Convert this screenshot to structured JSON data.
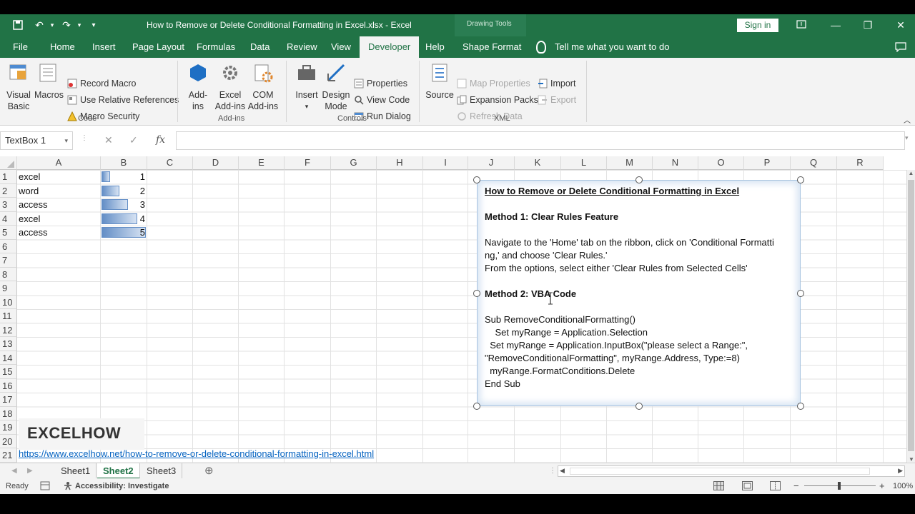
{
  "window": {
    "title": "How to Remove or Delete Conditional Formatting in Excel.xlsx  -  Excel",
    "context_label": "Drawing Tools",
    "sign_in": "Sign in"
  },
  "tabs": [
    "File",
    "Home",
    "Insert",
    "Page Layout",
    "Formulas",
    "Data",
    "Review",
    "View",
    "Developer",
    "Help",
    "Shape Format"
  ],
  "active_tab": "Developer",
  "tell_me": "Tell me what you want to do",
  "ribbon": {
    "code": {
      "label": "Code",
      "visual_basic": "Visual Basic",
      "macros": "Macros",
      "record_macro": "Record Macro",
      "relative_refs": "Use Relative References",
      "macro_security": "Macro Security"
    },
    "addins": {
      "label": "Add-ins",
      "addins": "Add-ins",
      "excel_addins": "Excel Add-ins",
      "com_addins": "COM Add-ins"
    },
    "controls": {
      "label": "Controls",
      "insert": "Insert",
      "design_mode": "Design Mode",
      "properties": "Properties",
      "view_code": "View Code",
      "run_dialog": "Run Dialog"
    },
    "xml": {
      "label": "XML",
      "source": "Source",
      "map_properties": "Map Properties",
      "expansion_packs": "Expansion Packs",
      "refresh_data": "Refresh Data",
      "import": "Import",
      "export": "Export"
    }
  },
  "formula_bar": {
    "name_box": "TextBox 1",
    "fx": "fx",
    "value": ""
  },
  "columns": [
    "A",
    "B",
    "C",
    "D",
    "E",
    "F",
    "G",
    "H",
    "I",
    "J",
    "K",
    "L",
    "M",
    "N",
    "O",
    "P",
    "Q",
    "R"
  ],
  "rows": [
    "1",
    "2",
    "3",
    "4",
    "5",
    "6",
    "7",
    "8",
    "9",
    "10",
    "11",
    "12",
    "13",
    "14",
    "15",
    "16",
    "17",
    "18",
    "19",
    "20",
    "21"
  ],
  "cells": [
    {
      "a": "excel",
      "b": "1"
    },
    {
      "a": "word",
      "b": "2"
    },
    {
      "a": "access",
      "b": "3"
    },
    {
      "a": "excel",
      "b": "4"
    },
    {
      "a": "access",
      "b": "5"
    }
  ],
  "databar_max": 5,
  "watermark": "EXCELHOW",
  "url": "https://www.excelhow.net/how-to-remove-or-delete-conditional-formatting-in-excel.html",
  "textbox": {
    "title": "How to Remove or Delete Conditional Formatting in Excel",
    "method1": "Method 1: Clear Rules Feature",
    "m1_line1": "Navigate to the 'Home' tab on the ribbon, click on 'Conditional Formatti",
    "m1_line2": "ng,' and choose 'Clear Rules.'",
    "m1_line3": "From the options, select either 'Clear Rules from Selected Cells'",
    "method2": "Method 2: VBA Code",
    "code1": "Sub RemoveConditionalFormatting()",
    "code2": "    Set myRange = Application.Selection",
    "code3": "  Set myRange = Application.InputBox(\"please select a Range:\",",
    "code4": "\"RemoveConditionalFormatting\", myRange.Address, Type:=8)",
    "code5": "  myRange.FormatConditions.Delete",
    "code6": "End Sub"
  },
  "sheets": [
    "Sheet1",
    "Sheet2",
    "Sheet3"
  ],
  "active_sheet": "Sheet2",
  "status": {
    "ready": "Ready",
    "accessibility": "Accessibility: Investigate",
    "zoom": "100%"
  },
  "colors": {
    "excel_green": "#217346",
    "databar": "#638ec6",
    "link": "#0563c1"
  }
}
